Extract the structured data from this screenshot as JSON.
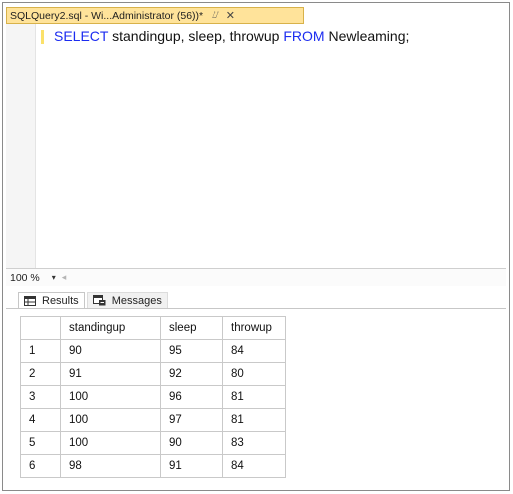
{
  "tab": {
    "title": "SQLQuery2.sql - Wi...Administrator (56))*",
    "pin_glyph": "⌰",
    "close_glyph": "✕"
  },
  "editor": {
    "keyword_select": "SELECT",
    "columns_text": " standingup, sleep, throwup ",
    "keyword_from": "FROM",
    "table_text": " Newleaming;"
  },
  "status": {
    "zoom": "100 %",
    "zoom_caret": "▾",
    "scroll_left": "◂"
  },
  "results_tabs": {
    "results_label": "Results",
    "messages_label": "Messages"
  },
  "grid": {
    "columns": [
      "standingup",
      "sleep",
      "throwup"
    ],
    "rows": [
      {
        "n": "1",
        "standingup": "90",
        "sleep": "95",
        "throwup": "84"
      },
      {
        "n": "2",
        "standingup": "91",
        "sleep": "92",
        "throwup": "80"
      },
      {
        "n": "3",
        "standingup": "100",
        "sleep": "96",
        "throwup": "81"
      },
      {
        "n": "4",
        "standingup": "100",
        "sleep": "97",
        "throwup": "81"
      },
      {
        "n": "5",
        "standingup": "100",
        "sleep": "90",
        "throwup": "83"
      },
      {
        "n": "6",
        "standingup": "98",
        "sleep": "91",
        "throwup": "84"
      }
    ]
  },
  "colors": {
    "tab_active": "#ffe39a",
    "keyword": "#1c2cf0"
  }
}
